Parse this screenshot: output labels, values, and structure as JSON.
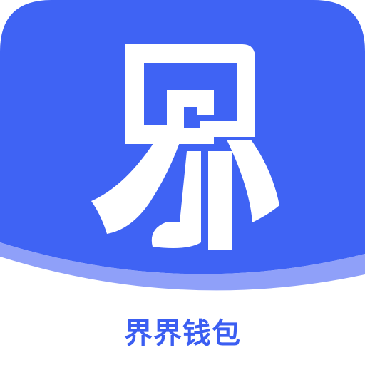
{
  "app": {
    "name": "界界钱包",
    "logo_glyph": "界",
    "logo_icon": "jie-character-logo-icon"
  },
  "colors": {
    "brand_blue": "#3f63f4",
    "wave_light": "#7b8ff8",
    "name_text": "#3b5ef2",
    "logo_fill": "#ffffff"
  }
}
